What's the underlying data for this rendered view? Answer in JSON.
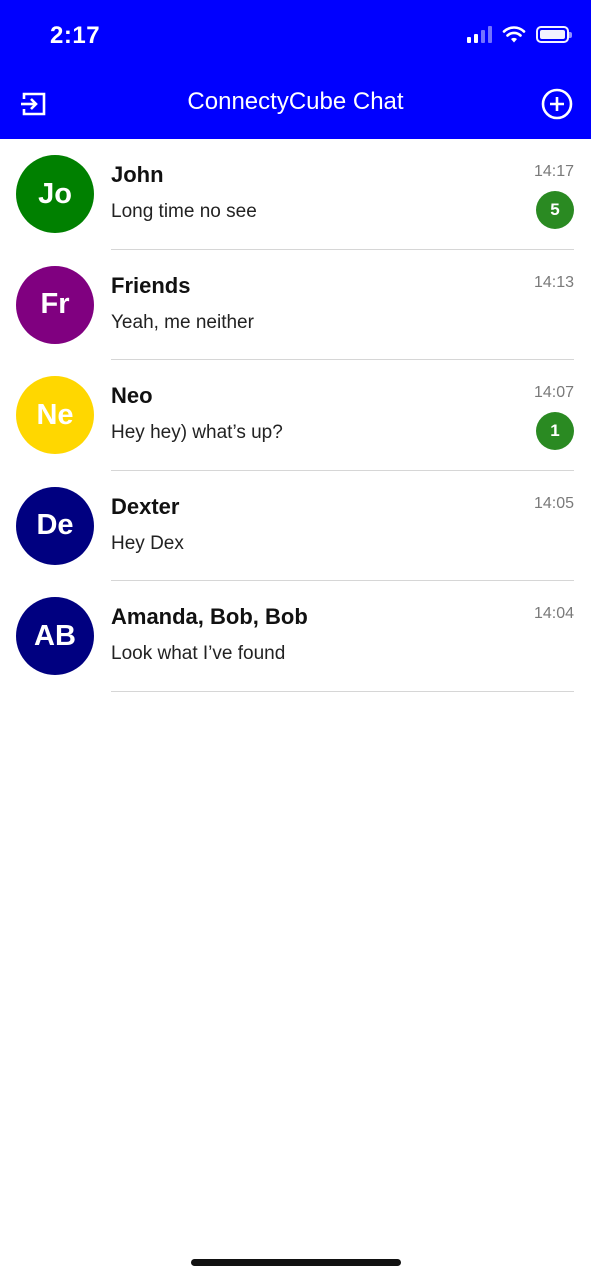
{
  "status_bar": {
    "time": "2:17",
    "icons": [
      "cellular-signal-icon",
      "wifi-icon",
      "battery-icon"
    ]
  },
  "nav": {
    "title": "ConnectyCube Chat",
    "left_icon": "logout-icon",
    "right_icon": "add-circle-icon",
    "background_color": "#0000ff"
  },
  "chats": [
    {
      "initials": "Jo",
      "name": "John",
      "last_message": "Long time no see",
      "time": "14:17",
      "unread": "5",
      "avatar_color": "#008000"
    },
    {
      "initials": "Fr",
      "name": "Friends",
      "last_message": "Yeah, me neither",
      "time": "14:13",
      "unread": "",
      "avatar_color": "#800080"
    },
    {
      "initials": "Ne",
      "name": "Neo",
      "last_message": "Hey hey) what’s up?",
      "time": "14:07",
      "unread": "1",
      "avatar_color": "#ffd700"
    },
    {
      "initials": "De",
      "name": "Dexter",
      "last_message": "Hey Dex",
      "time": "14:05",
      "unread": "",
      "avatar_color": "#000080"
    },
    {
      "initials": "AB",
      "name": "Amanda, Bob, Bob",
      "last_message": "Look what I’ve found",
      "time": "14:04",
      "unread": "",
      "avatar_color": "#000080"
    }
  ],
  "badge_color": "#2a8a22"
}
